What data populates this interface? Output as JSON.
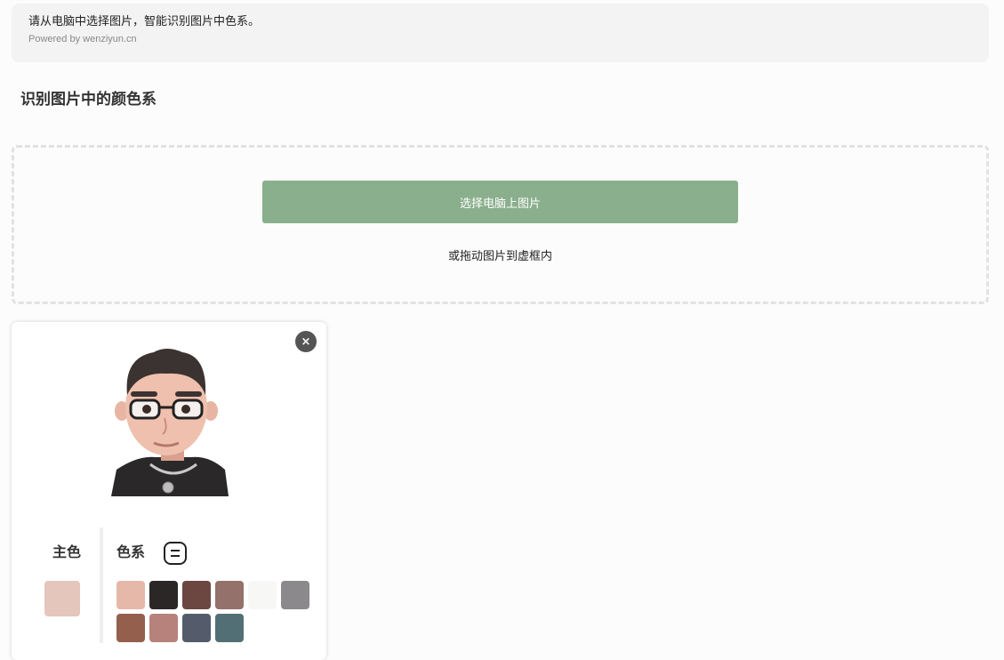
{
  "notice": {
    "text": "请从电脑中选择图片，智能识别图片中色系。",
    "powered_by": "Powered by wenziyun.cn"
  },
  "page_title": "识别图片中的颜色系",
  "dropzone": {
    "select_button_label": "选择电脑上图片",
    "drag_hint": "或拖动图片到虚框内"
  },
  "result_card": {
    "close_icon": "×",
    "main_color_label": "主色",
    "main_color": "#e5c6bc",
    "palette_label": "色系",
    "palette": [
      "#e6b8a9",
      "#2c2727",
      "#6c4641",
      "#94716a",
      "#f7f7f5",
      "#8b898b",
      "#955f4e",
      "#b8827c",
      "#545c6c",
      "#536f76"
    ]
  }
}
